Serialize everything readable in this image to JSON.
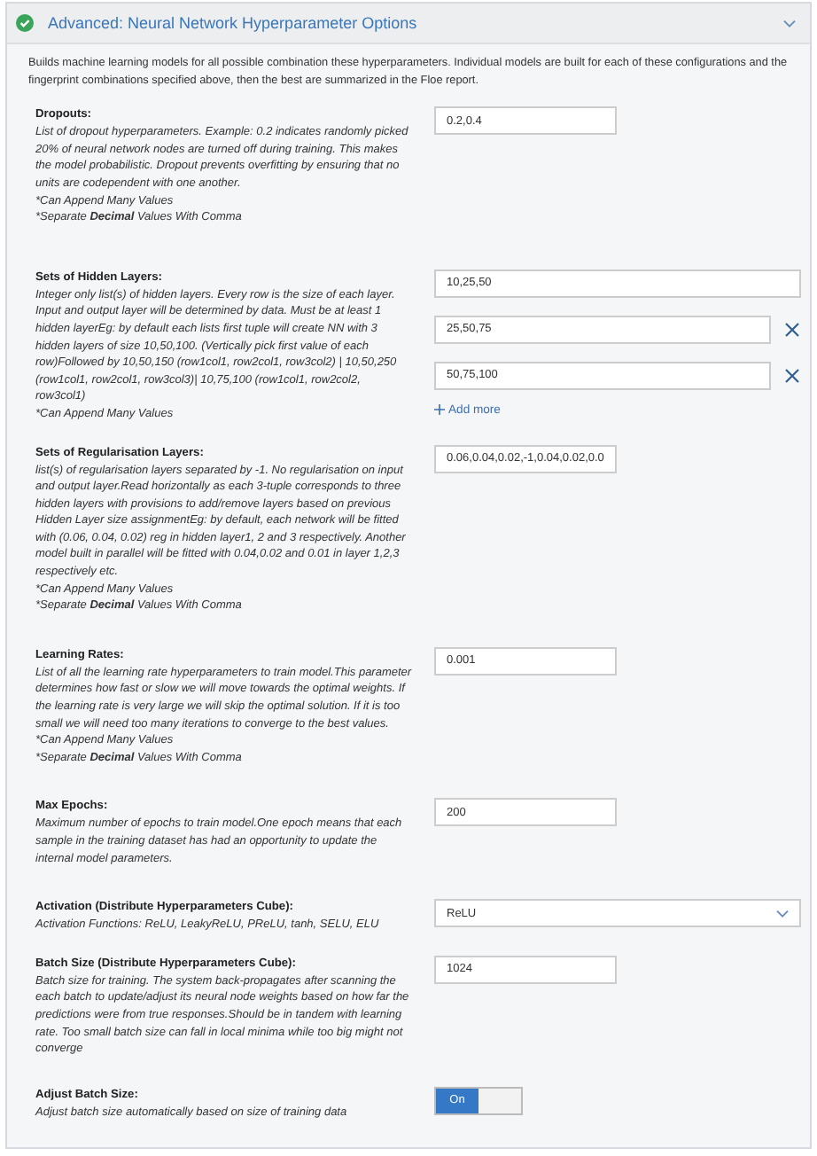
{
  "panel": {
    "title": "Advanced: Neural Network Hyperparameter Options",
    "complete": true,
    "expanded": true,
    "intro": "Builds machine learning models for all possible combination these hyperparameters. Individual models are built for each of these configurations and the fingerprint combinations specified above, then the best are summarized in the Floe report."
  },
  "fields": [
    {
      "kind": "text",
      "label": "Dropouts:",
      "description": "List of dropout hyperparameters. Example: 0.2 indicates randomly picked 20% of neural network nodes are turned off during training. This makes the model probabilistic. Dropout prevents overfitting by ensuring that no units are codependent with one another.",
      "notes": [
        "*Can Append Many Values",
        "*Separate **Decimal** Values With Comma"
      ],
      "value": "0.2,0.4"
    },
    {
      "kind": "multi",
      "label": "Sets of Hidden Layers:",
      "description": "Integer only list(s) of hidden layers. Every row is the size of each layer. Input and output layer will be determined by data. Must be at least 1 hidden layerEg: by default each lists first tuple will create NN with 3 hidden layers of size 10,50,100. (Vertically pick first value of each row)Followed by 10,50,150 (row1col1, row2col1, row3col2) | 10,50,250 (row1col1, row2col1, row3col3)| 10,75,100 (row1col1, row2col2, row3col1)",
      "notes": [
        "*Can Append Many Values"
      ],
      "values": [
        "10,25,50",
        "25,50,75",
        "50,75,100"
      ],
      "add_label": "Add more"
    },
    {
      "kind": "text",
      "label": "Sets of Regularisation Layers:",
      "description": "list(s) of regularisation layers separated by -1. No regularisation on input and output layer.Read horizontally as each 3-tuple corresponds to three hidden layers with provisions to add/remove layers based on previous Hidden Layer size assignmentEg: by default, each network will be fitted with (0.06, 0.04, 0.02) reg in hidden layer1, 2 and 3 respectively. Another model built in parallel will be fitted with 0.04,0.02 and 0.01 in layer 1,2,3 respectively etc.",
      "notes": [
        "*Can Append Many Values",
        "*Separate **Decimal** Values With Comma"
      ],
      "value": "0.06,0.04,0.02,-1,0.04,0.02,0.0"
    },
    {
      "kind": "text",
      "label": "Learning Rates:",
      "description": "List of all the learning rate hyperparameters to train model.This parameter determines how fast or slow we will move towards the optimal weights. If the learning rate is very large we will skip the optimal solution. If it is too small we will need too many iterations to converge to the best values.",
      "notes": [
        "*Can Append Many Values",
        "*Separate **Decimal** Values With Comma"
      ],
      "value": "0.001"
    },
    {
      "kind": "text",
      "label": "Max Epochs:",
      "description": "Maximum number of epochs to train model.One epoch means that each sample in the training dataset has had an opportunity to update the internal model parameters.",
      "value": "200"
    },
    {
      "kind": "select",
      "label": "Activation (Distribute Hyperparameters Cube):",
      "description": "Activation Functions: ReLU, LeakyReLU, PReLU, tanh, SELU, ELU",
      "value": "ReLU"
    },
    {
      "kind": "text",
      "label": "Batch Size (Distribute Hyperparameters Cube):",
      "description": "Batch size for training. The system back-propagates after scanning the each batch to update/adjust its neural node weights based on how far the predictions were from true responses.Should be in tandem with learning rate. Too small batch size can fall in local minima while too big might not converge",
      "value": "1024"
    },
    {
      "kind": "toggle",
      "label": "Adjust Batch Size:",
      "description": "Adjust batch size automatically based on size of training data",
      "on": true,
      "on_label": "On"
    }
  ]
}
